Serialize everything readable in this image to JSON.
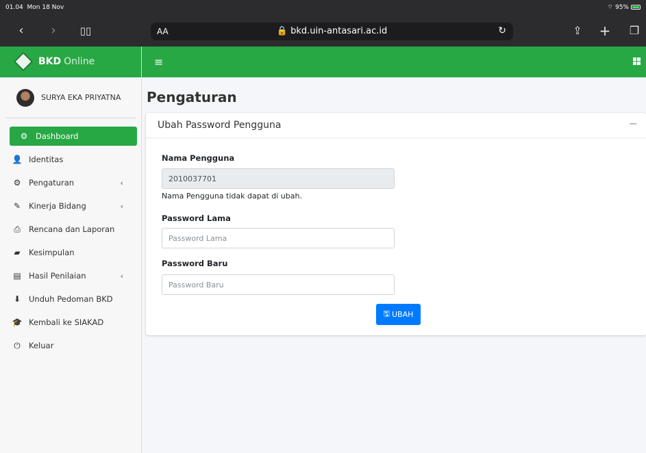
{
  "status": {
    "time": "01.04",
    "date": "Mon 18 Nov",
    "battery": "95%"
  },
  "browser": {
    "aa": "AA",
    "url": "bkd.uin-antasari.ac.id"
  },
  "brand": {
    "name_bold": "BKD",
    "name_thin": "Online"
  },
  "user": {
    "name": "SURYA EKA PRIYATNA"
  },
  "sidebar": {
    "items": [
      {
        "label": "Dashboard",
        "icon": "dashboard-icon",
        "glyph": "⚙",
        "active": true
      },
      {
        "label": "Identitas",
        "icon": "user-icon",
        "glyph": "👤"
      },
      {
        "label": "Pengaturan",
        "icon": "cog-icon",
        "glyph": "⚙",
        "chevron": "‹"
      },
      {
        "label": "Kinerja Bidang",
        "icon": "edit-icon",
        "glyph": "✎",
        "chevron": "‹"
      },
      {
        "label": "Rencana dan Laporan",
        "icon": "print-icon",
        "glyph": "⎙"
      },
      {
        "label": "Kesimpulan",
        "icon": "book-icon",
        "glyph": "▰"
      },
      {
        "label": "Hasil Penilaian",
        "icon": "file-icon",
        "glyph": "▤",
        "chevron": "‹"
      },
      {
        "label": "Unduh Pedoman BKD",
        "icon": "download-icon",
        "glyph": "⬇"
      },
      {
        "label": "Kembali ke SIAKAD",
        "icon": "graduation-cap-icon",
        "glyph": "🎓"
      },
      {
        "label": "Keluar",
        "icon": "power-icon",
        "glyph": "⏻"
      }
    ]
  },
  "page": {
    "title": "Pengaturan"
  },
  "card": {
    "title": "Ubah Password Pengguna",
    "collapse": "−",
    "username_label": "Nama Pengguna",
    "username_value": "2010037701",
    "username_help": "Nama Pengguna tidak dapat di ubah.",
    "old_pw_label": "Password Lama",
    "old_pw_placeholder": "Password Lama",
    "new_pw_label": "Password Baru",
    "new_pw_placeholder": "Password Baru",
    "submit_label": "UBAH"
  },
  "colors": {
    "brand_green": "#28a745",
    "primary_blue": "#007bff"
  }
}
